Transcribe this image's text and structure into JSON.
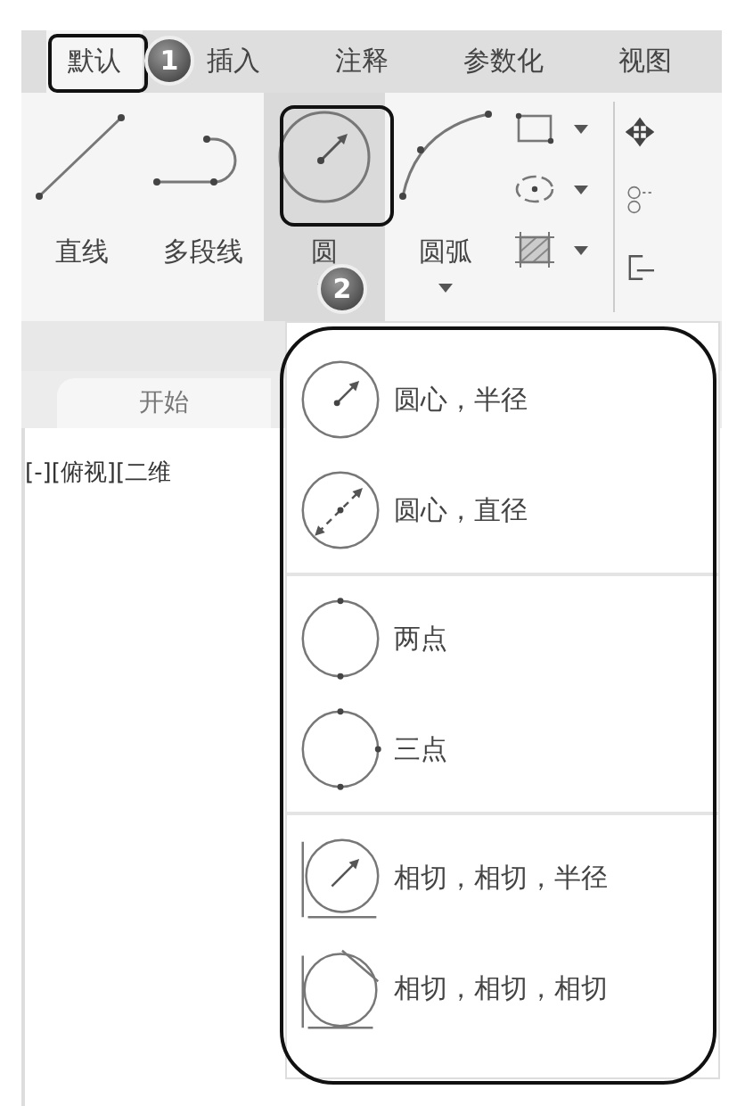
{
  "tabs": [
    {
      "label": "默认",
      "selected": true
    },
    {
      "label": "插入",
      "selected": false
    },
    {
      "label": "注释",
      "selected": false
    },
    {
      "label": "参数化",
      "selected": false
    },
    {
      "label": "视图",
      "selected": false
    }
  ],
  "ribbon": {
    "tools": [
      {
        "label": "直线",
        "kind": "line",
        "selected": false,
        "dropdown": false
      },
      {
        "label": "多段线",
        "kind": "polyline",
        "selected": false,
        "dropdown": false
      },
      {
        "label": "圆",
        "kind": "circle",
        "selected": true,
        "dropdown": true
      },
      {
        "label": "圆弧",
        "kind": "arc",
        "selected": false,
        "dropdown": true
      }
    ],
    "small_tools": [
      {
        "kind": "rectangle"
      },
      {
        "kind": "ellipse"
      },
      {
        "kind": "hatch"
      }
    ]
  },
  "file_tab": {
    "label": "开始"
  },
  "viewport_label": "[-][俯视][二维",
  "circle_menu": {
    "groups": [
      [
        {
          "label": "圆心，半径",
          "kind": "center-radius"
        },
        {
          "label": "圆心，直径",
          "kind": "center-diameter"
        }
      ],
      [
        {
          "label": "两点",
          "kind": "two-point"
        },
        {
          "label": "三点",
          "kind": "three-point"
        }
      ],
      [
        {
          "label": "相切，相切，半径",
          "kind": "tan-tan-radius"
        },
        {
          "label": "相切，相切，相切",
          "kind": "tan-tan-tan"
        }
      ]
    ]
  },
  "callouts": [
    {
      "number": "1"
    },
    {
      "number": "2"
    }
  ]
}
